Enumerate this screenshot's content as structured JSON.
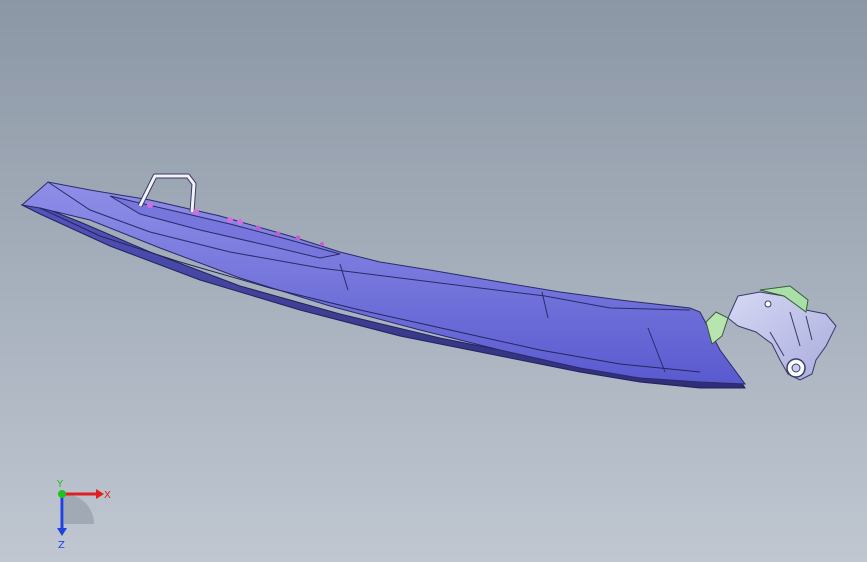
{
  "viewport": {
    "background_top": "#8c97a5",
    "background_bottom": "#c0c7d1",
    "model_color": "#6a6ad8",
    "model_dark": "#3b3b8a",
    "bracket_color": "#c8ccf0",
    "bracket_accent": "#a8e0a8",
    "fastener_color": "#d070e0"
  },
  "triad": {
    "x_label": "X",
    "y_label": "Y",
    "z_label": "Z",
    "x_color": "#e02020",
    "y_color": "#20c020",
    "z_color": "#2040e0"
  }
}
